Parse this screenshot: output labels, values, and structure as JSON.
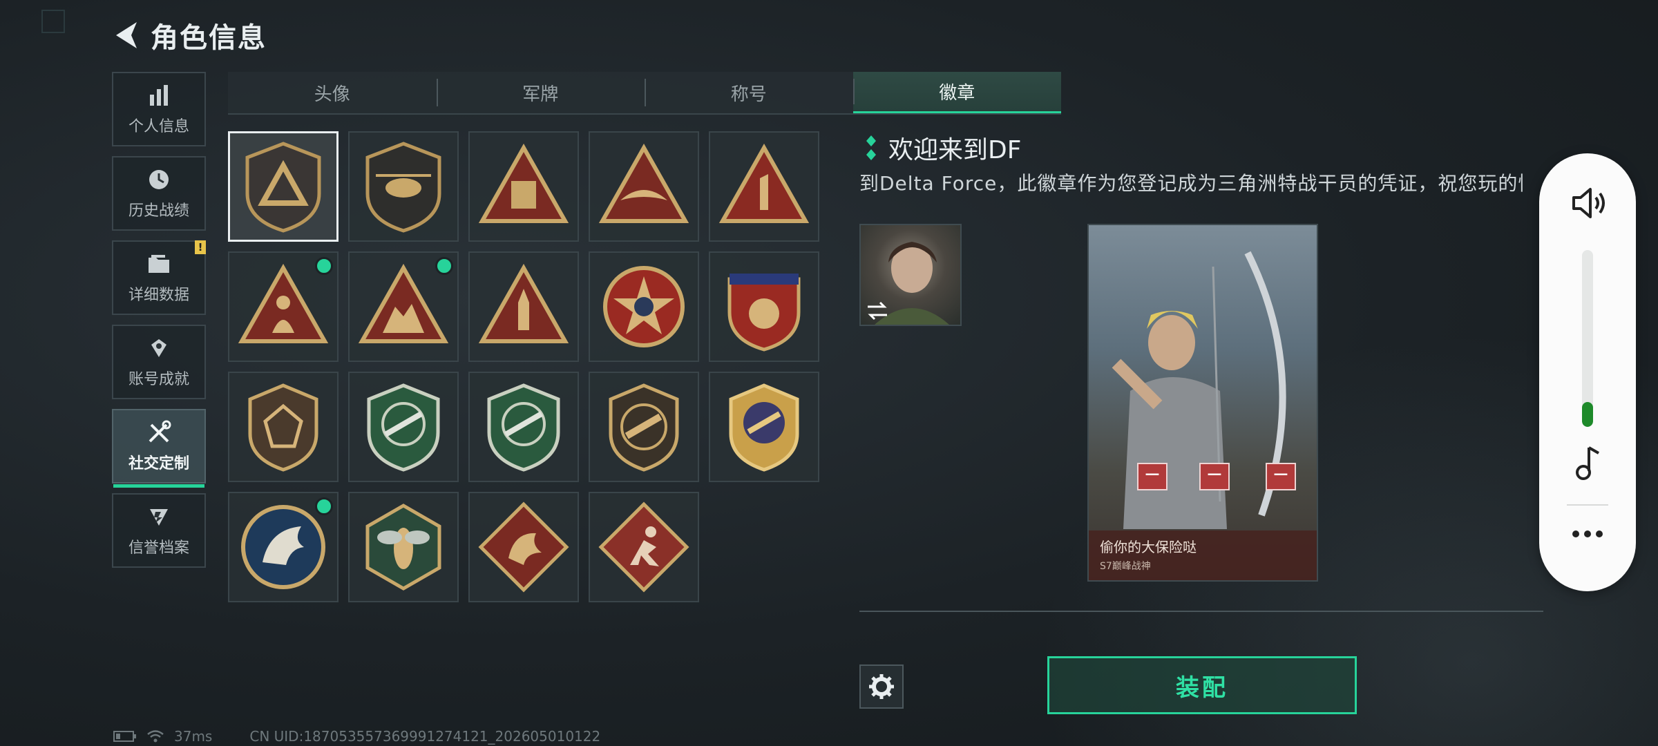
{
  "header": {
    "title": "角色信息"
  },
  "nav": [
    {
      "label": "个人信息",
      "icon": "bar-chart-icon"
    },
    {
      "label": "历史战绩",
      "icon": "clock-icon"
    },
    {
      "label": "详细数据",
      "icon": "folder-icon",
      "badge": "!"
    },
    {
      "label": "账号成就",
      "icon": "achievement-icon"
    },
    {
      "label": "社交定制",
      "icon": "tools-icon",
      "active": true
    },
    {
      "label": "信誉档案",
      "icon": "credit-icon"
    }
  ],
  "tabs": [
    {
      "label": "头像"
    },
    {
      "label": "军牌"
    },
    {
      "label": "称号"
    },
    {
      "label": "徽章",
      "active": true
    }
  ],
  "badges": [
    {
      "icon": "delta-shield-badge-icon",
      "selected": true
    },
    {
      "icon": "helicopter-shield-badge-icon"
    },
    {
      "icon": "s7-triangle-badge-icon"
    },
    {
      "icon": "wing-triangle-badge-icon"
    },
    {
      "icon": "number-one-triangle-badge-icon"
    },
    {
      "icon": "soldier-triangle-badge-icon",
      "new": true
    },
    {
      "icon": "squad-triangle-badge-icon",
      "new": true
    },
    {
      "icon": "rocket-triangle-badge-icon"
    },
    {
      "icon": "star-round-badge-icon"
    },
    {
      "icon": "crest-stars-badge-icon"
    },
    {
      "icon": "gem-shield-badge-icon"
    },
    {
      "icon": "rifle-green-shield-badge-icon"
    },
    {
      "icon": "rifle-green-shield-2-badge-icon"
    },
    {
      "icon": "pistol-dark-shield-badge-icon"
    },
    {
      "icon": "gold-crest-badge-icon"
    },
    {
      "icon": "eagle-round-badge-icon",
      "new": true
    },
    {
      "icon": "wasp-hexagon-badge-icon"
    },
    {
      "icon": "dragon-diamond-badge-icon"
    },
    {
      "icon": "runner-diamond-badge-icon"
    }
  ],
  "detail": {
    "title": "欢迎来到DF",
    "description": "到Delta Force，此徽章作为您登记成为三角洲特战干员的凭证，祝您玩的愉快",
    "card_title": "偷你的大保险哒",
    "card_subtitle": "S7巅峰战神",
    "equip_label": "装配"
  },
  "volume": {
    "level": 0.14
  },
  "status": {
    "ping": "37ms",
    "uid": "CN UID:1870535573699912741​21_202605010122"
  },
  "colors": {
    "accent": "#27d39a",
    "warn": "#e8c44a",
    "remove": "#b13a3a"
  }
}
